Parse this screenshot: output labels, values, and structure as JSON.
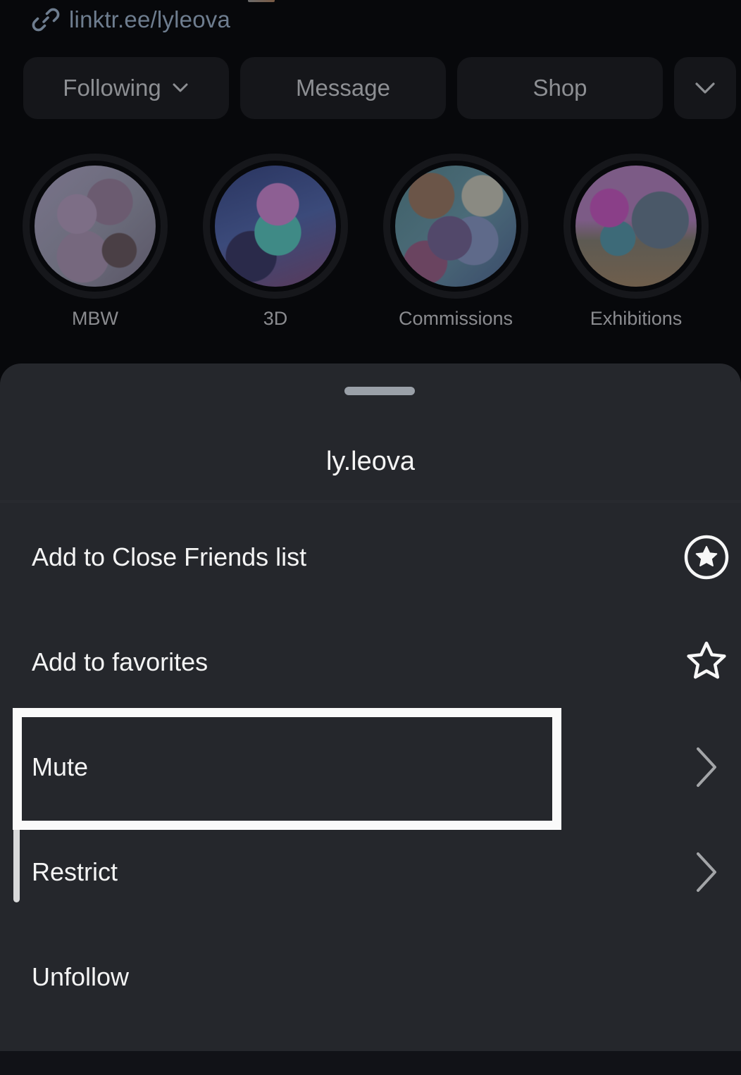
{
  "profile": {
    "link": {
      "icon": "link-icon",
      "text": "linktr.ee/lyleova"
    },
    "buttons": {
      "following_label": "Following",
      "message_label": "Message",
      "shop_label": "Shop",
      "more_icon": "chevron-down-icon"
    },
    "highlights": [
      {
        "label": "MBW"
      },
      {
        "label": "3D"
      },
      {
        "label": "Commissions"
      },
      {
        "label": "Exhibitions"
      }
    ]
  },
  "sheet": {
    "title": "ly.leova",
    "items": [
      {
        "label": "Add to Close Friends list",
        "icon": "close-friends-star-circle-icon"
      },
      {
        "label": "Add to favorites",
        "icon": "star-outline-icon"
      },
      {
        "label": "Mute",
        "icon": "chevron-right-icon",
        "highlighted": true
      },
      {
        "label": "Restrict",
        "icon": "chevron-right-icon"
      },
      {
        "label": "Unfollow",
        "icon": null
      }
    ]
  },
  "colors": {
    "sheet_background": "#25272c",
    "page_background": "#07080b",
    "highlight_border": "#fafafa",
    "link_text": "#6e7d8f"
  }
}
